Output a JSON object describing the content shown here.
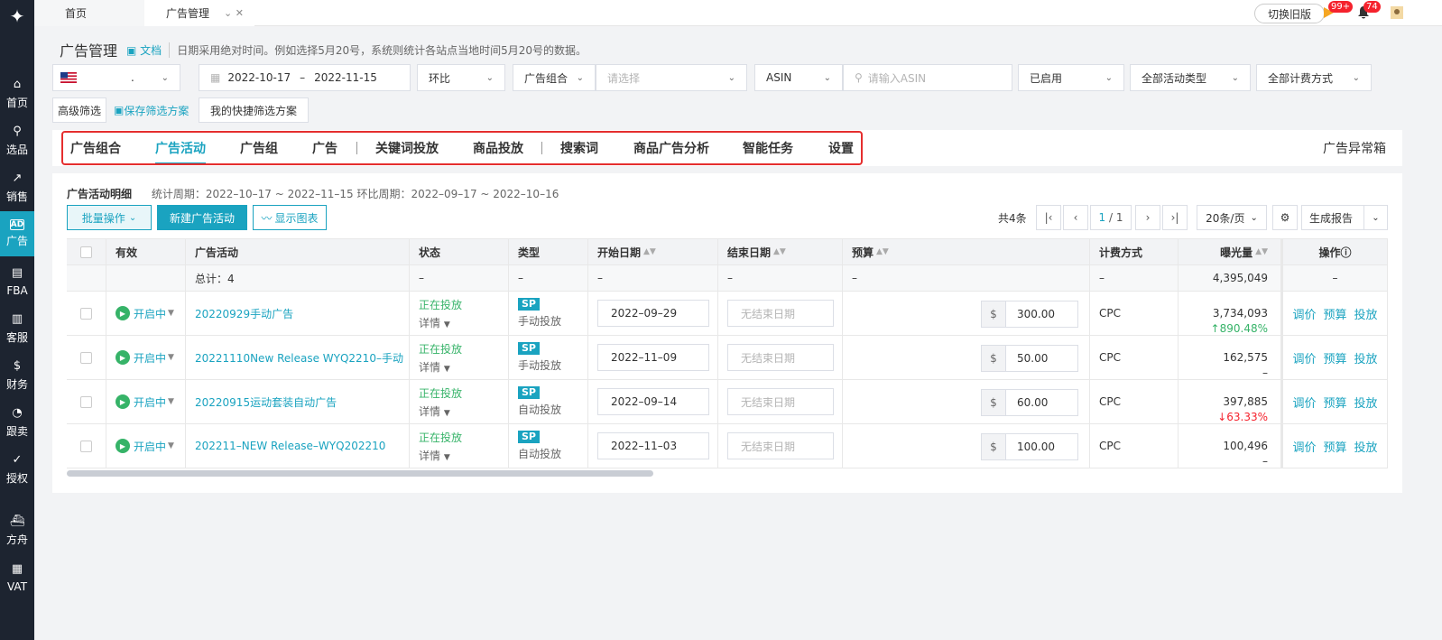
{
  "sidebar": {
    "logo": "✦",
    "items": [
      {
        "label": "首页",
        "icon": "home-icon",
        "glyph": "⌂"
      },
      {
        "label": "选品",
        "icon": "search-icon",
        "glyph": "⚲"
      },
      {
        "label": "销售",
        "icon": "chart-icon",
        "glyph": "↗"
      },
      {
        "label": "广告",
        "icon": "ad-icon",
        "glyph": "AD",
        "active": true
      },
      {
        "label": "FBA",
        "icon": "fba-icon",
        "glyph": "▤"
      },
      {
        "label": "客服",
        "icon": "service-icon",
        "glyph": "▥"
      },
      {
        "label": "财务",
        "icon": "finance-icon",
        "glyph": "$"
      },
      {
        "label": "跟卖",
        "icon": "follow-icon",
        "glyph": "◔"
      },
      {
        "label": "授权",
        "icon": "shield-icon",
        "glyph": "✓"
      },
      {
        "label": "方舟",
        "icon": "ark-icon",
        "glyph": "⛴"
      },
      {
        "label": "VAT",
        "icon": "vat-icon",
        "glyph": "▦"
      }
    ]
  },
  "topbar": {
    "tabs": [
      {
        "label": "首页"
      },
      {
        "label": "广告管理"
      }
    ],
    "tab_controls": "⌄ ✕",
    "switch_label": "切换旧版",
    "flag_badge": "99+",
    "bell_badge": "74"
  },
  "page": {
    "title": "广告管理",
    "doc_link": "文档",
    "note": "日期采用绝对时间。例如选择5月20号，系统则统计各站点当地时间5月20号的数据。"
  },
  "filters": {
    "store": ".",
    "date_start": "2022-10-17",
    "date_sep": "–",
    "date_end": "2022-11-15",
    "compare": "环比",
    "portfolio": "广告组合",
    "portfolio_placeholder": "请选择",
    "asin_type": "ASIN",
    "asin_placeholder": "请输入ASIN",
    "enabled": "已启用",
    "campaign_type": "全部活动类型",
    "billing": "全部计费方式",
    "advanced": "高级筛选",
    "save_scheme": "保存筛选方案",
    "quick_scheme": "我的快捷筛选方案"
  },
  "tabs": [
    {
      "label": "广告组合"
    },
    {
      "label": "广告活动"
    },
    {
      "label": "广告组"
    },
    {
      "label": "广告"
    },
    {
      "label": "关键词投放"
    },
    {
      "label": "商品投放"
    },
    {
      "label": "搜索词"
    },
    {
      "label": "商品广告分析"
    },
    {
      "label": "智能任务"
    },
    {
      "label": "设置"
    }
  ],
  "anomaly": "广告异常箱",
  "panel": {
    "title": "广告活动明细",
    "period": "统计周期：2022–10–17 ~ 2022–11–15 环比周期：2022–09–17 ~ 2022–10–16",
    "batch": "批量操作",
    "new_campaign": "新建广告活动",
    "show_chart": "显示图表",
    "total_count": "共4条",
    "page_current": "1",
    "page_total": "/ 1",
    "page_size": "20条/页",
    "report": "生成报告"
  },
  "table": {
    "headers": {
      "valid": "有效",
      "campaign": "广告活动",
      "status": "状态",
      "type": "类型",
      "start": "开始日期",
      "end": "结束日期",
      "budget": "预算",
      "billing": "计费方式",
      "impressions": "曝光量",
      "ops": "操作ⓘ"
    },
    "total": {
      "label": "总计：4",
      "status": "–",
      "type": "–",
      "start": "–",
      "end": "–",
      "budget": "–",
      "billing": "–",
      "impressions": "4,395,049",
      "ops": "–"
    },
    "rows": [
      {
        "valid": "开启中",
        "name": "20220929手动广告",
        "status": "正在投放",
        "detail": "详情",
        "type_badge": "SP",
        "type": "手动投放",
        "start": "2022–09–29",
        "end_placeholder": "无结束日期",
        "currency": "$",
        "budget": "300.00",
        "billing": "CPC",
        "impressions": "3,734,093",
        "change": "↑890.48%",
        "op1": "调价",
        "op2": "预算",
        "op3": "投放"
      },
      {
        "valid": "开启中",
        "name": "20221110New Release WYQ2210–手动",
        "status": "正在投放",
        "detail": "详情",
        "type_badge": "SP",
        "type": "手动投放",
        "start": "2022–11–09",
        "end_placeholder": "无结束日期",
        "currency": "$",
        "budget": "50.00",
        "billing": "CPC",
        "impressions": "162,575",
        "change": "–",
        "op1": "调价",
        "op2": "预算",
        "op3": "投放"
      },
      {
        "valid": "开启中",
        "name": "20220915运动套装自动广告",
        "status": "正在投放",
        "detail": "详情",
        "type_badge": "SP",
        "type": "自动投放",
        "start": "2022–09–14",
        "end_placeholder": "无结束日期",
        "currency": "$",
        "budget": "60.00",
        "billing": "CPC",
        "impressions": "397,885",
        "change": "↓63.33%",
        "op1": "调价",
        "op2": "预算",
        "op3": "投放"
      },
      {
        "valid": "开启中",
        "name": "202211–NEW Release–WYQ202210",
        "status": "正在投放",
        "detail": "详情",
        "type_badge": "SP",
        "type": "自动投放",
        "start": "2022–11–03",
        "end_placeholder": "无结束日期",
        "currency": "$",
        "budget": "100.00",
        "billing": "CPC",
        "impressions": "100,496",
        "change": "–",
        "op1": "调价",
        "op2": "预算",
        "op3": "投放"
      }
    ]
  },
  "colors": {
    "accent": "#1aa3c0",
    "sidebar": "#1d2430",
    "highlight": "#e52e2e",
    "up": "#36b368",
    "down": "#f5222d"
  }
}
